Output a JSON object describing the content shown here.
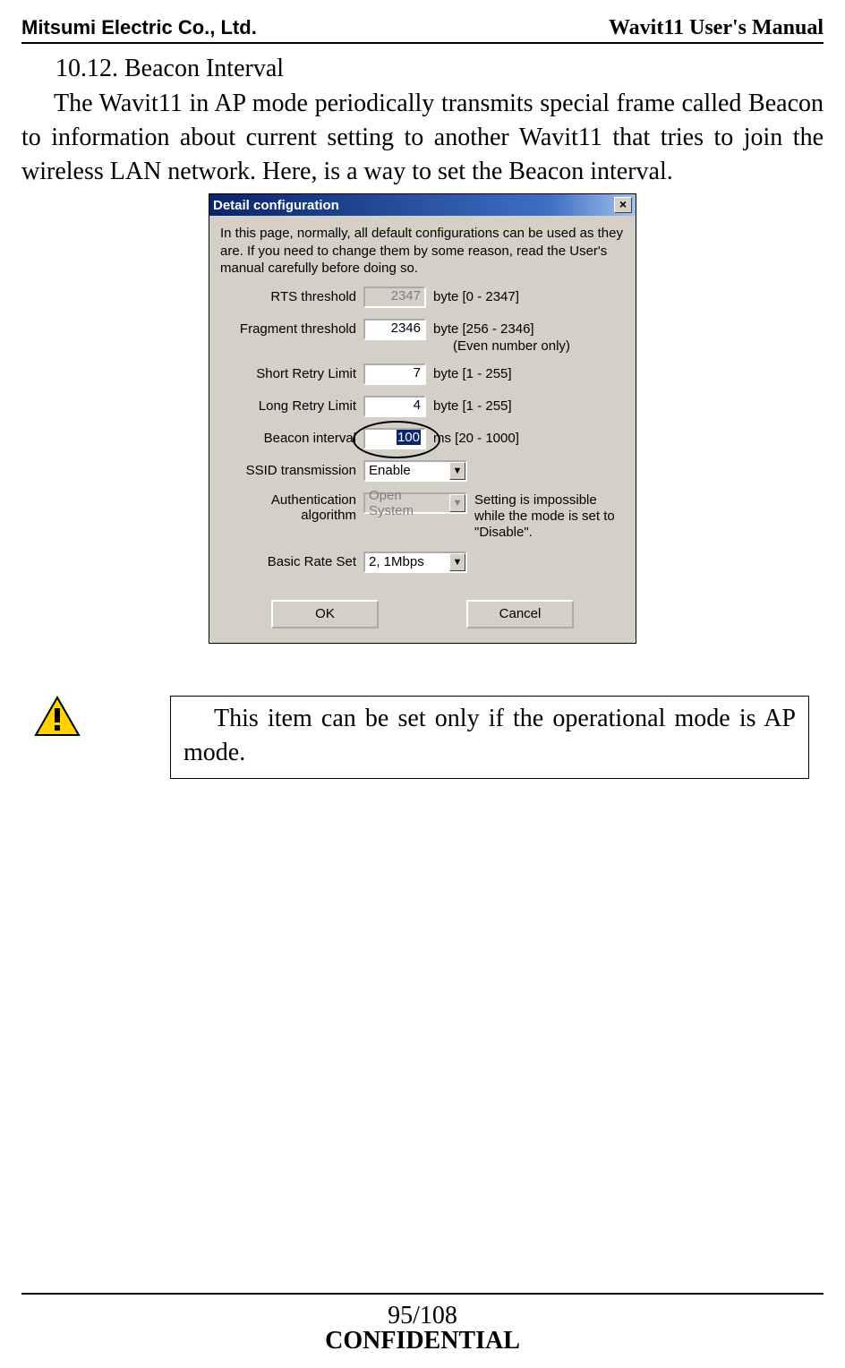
{
  "header": {
    "left": "Mitsumi Electric Co., Ltd.",
    "right": "Wavit11 User's Manual"
  },
  "section_heading": "10.12. Beacon Interval",
  "body_text": "The Wavit11 in AP mode periodically transmits special frame called Beacon to information about current setting to another Wavit11 that tries to join the wireless LAN network. Here, is a way to set the Beacon interval.",
  "dialog": {
    "title": "Detail configuration",
    "close_glyph": "×",
    "intro": "In this page, normally, all default configurations can be used as they are. If you need to change them by some reason, read the User's manual carefully before doing so.",
    "fields": {
      "rts": {
        "label": "RTS threshold",
        "value": "2347",
        "hint": "byte [0 - 2347]",
        "readonly": true
      },
      "fragment": {
        "label": "Fragment threshold",
        "value": "2346",
        "hint": "byte [256 - 2346]",
        "sub": "(Even number only)"
      },
      "short_retry": {
        "label": "Short Retry Limit",
        "value": "7",
        "hint": "byte [1 - 255]"
      },
      "long_retry": {
        "label": "Long Retry Limit",
        "value": "4",
        "hint": "byte [1 - 255]"
      },
      "beacon": {
        "label": "Beacon interval",
        "value": "100",
        "hint": "ms [20 - 1000]"
      },
      "ssid": {
        "label": "SSID transmission",
        "value": "Enable"
      },
      "auth": {
        "label": "Authentication algorithm",
        "value": "Open System",
        "note": "Setting is impossible while the mode is set to \"Disable\"."
      },
      "basic_rate": {
        "label": "Basic Rate Set",
        "value": "2, 1Mbps"
      }
    },
    "buttons": {
      "ok": "OK",
      "cancel": "Cancel"
    }
  },
  "note_text": "This item can be set only if the operational mode is AP mode.",
  "footer": {
    "page": "95/108",
    "confidential": "CONFIDENTIAL"
  }
}
